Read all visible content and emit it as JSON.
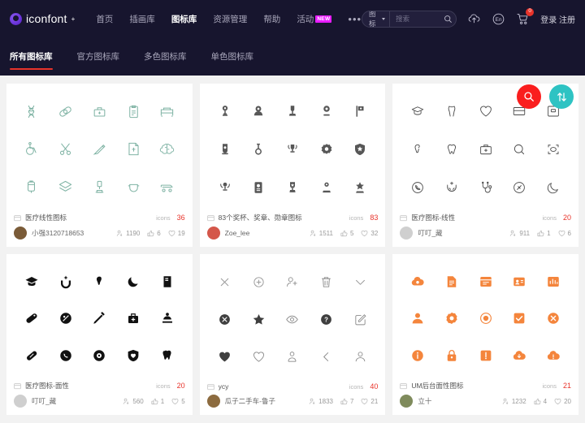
{
  "header": {
    "logo_text": "iconfont",
    "logo_plus": "+",
    "nav": [
      {
        "label": "首页",
        "active": false
      },
      {
        "label": "插画库",
        "active": false
      },
      {
        "label": "图标库",
        "active": true
      },
      {
        "label": "资源管理",
        "active": false
      },
      {
        "label": "帮助",
        "active": false
      },
      {
        "label": "活动",
        "active": false,
        "badge": "NEW"
      }
    ],
    "more_label": "•••",
    "search": {
      "category": "图标",
      "placeholder": "搜索",
      "value": ""
    },
    "upload_icon": "cloud-upload-icon",
    "language_icon": "language-en-icon",
    "cart_icon": "shopping-cart-icon",
    "cart_count": "0",
    "auth": "登录 注册"
  },
  "tabs": [
    {
      "label": "所有图标库",
      "active": true
    },
    {
      "label": "官方图标库",
      "active": false
    },
    {
      "label": "多色图标库",
      "active": false
    },
    {
      "label": "单色图标库",
      "active": false
    }
  ],
  "fab": {
    "search_label": "search-icon",
    "sort_label": "sort-updown-icon"
  },
  "colors": {
    "accent_red": "#e8332a",
    "fab_red": "#fa1e1e",
    "fab_teal": "#2ec3c3",
    "header_bg": "#17152e",
    "page_bg": "#f2f2f2",
    "badge_new": "#e81cff",
    "card1_icons": "#7fb3a4",
    "card2_icons": "#575757",
    "card3_icons": "#4a4a4a",
    "card4_icons": "#111111",
    "card5_icons": "#6b6b6b",
    "card6_icons": "#f4853c"
  },
  "icons_label": "icons",
  "cards": [
    {
      "title": "医疗线性图标",
      "icon_count": "36",
      "author": "小强3120718653",
      "avatar_color": "#7a5b38",
      "downloads": "1190",
      "likes": "6",
      "favorites": "19",
      "icon_color": "#7fb3a4",
      "icon_style": "line",
      "icons": [
        "dna-icon",
        "bandage-icon",
        "medical-scale-icon",
        "clipboard-icon",
        "hospital-bed-icon",
        "wheelchair-icon",
        "scissors-icon",
        "thermometer-icon",
        "prescription-icon",
        "brain-icon",
        "iv-bag-icon",
        "layers-icon",
        "microscope-icon",
        "face-mask-icon",
        "stretcher-icon"
      ]
    },
    {
      "title": "83个奖杯、奖章、勋章图标",
      "icon_count": "83",
      "author": "Zoe_lee",
      "avatar_color": "#d4574a",
      "downloads": "1511",
      "likes": "5",
      "favorites": "32",
      "icon_color": "#575757",
      "icon_style": "solid",
      "icons": [
        "trophy-cup-icon",
        "medal-round-icon",
        "trophy-tall-icon",
        "award-badge-icon",
        "flag-award-icon",
        "medal-pin-icon",
        "medal-ribbon-icon",
        "trophy-wreath-icon",
        "rosette-icon",
        "shield-award-icon",
        "laurel-trophy-icon",
        "certificate-icon",
        "trophy-star-icon",
        "podium-icon",
        "star-badge-icon"
      ]
    },
    {
      "title": "医疗图标-线性",
      "icon_count": "20",
      "author": "叮叮_藏",
      "avatar_color": "#cfcfcf",
      "downloads": "911",
      "likes": "1",
      "favorites": "6",
      "icon_color": "#4a4a4a",
      "icon_style": "thin-line",
      "icons": [
        "graduation-cap-icon",
        "hands-care-icon",
        "heart-outline-icon",
        "card-icon",
        "archive-box-icon",
        "tooth-root-icon",
        "tooth-icon",
        "medicine-box-icon",
        "search-circle-icon",
        "scan-frame-icon",
        "phone-care-icon",
        "hands-sparkle-icon",
        "stethoscope-icon",
        "pill-circle-icon",
        "moon-care-icon"
      ]
    },
    {
      "title": "医疗图标-面性",
      "icon_count": "20",
      "author": "叮叮_藏",
      "avatar_color": "#cfcfcf",
      "downloads": "560",
      "likes": "1",
      "favorites": "5",
      "icon_color": "#111111",
      "icon_style": "solid",
      "icons": [
        "graduation-cap-filled-icon",
        "hands-sparkle-filled-icon",
        "tooth-root-filled-icon",
        "moon-care-filled-icon",
        "book-filled-icon",
        "pill-filled-icon",
        "pill-circle-filled-icon",
        "syringe-icon",
        "medicine-box-filled-icon",
        "microscope-filled-icon",
        "capsule-filled-icon",
        "phone-circle-filled-icon",
        "virus-circle-filled-icon",
        "shield-heart-filled-icon",
        "tooth-filled-icon"
      ]
    },
    {
      "title": "ycy",
      "icon_count": "40",
      "author": "瓜子二手车-鲁子",
      "avatar_color": "#8c6b3f",
      "downloads": "1833",
      "likes": "7",
      "favorites": "21",
      "icon_color": "#6b6b6b",
      "icon_style": "mixed",
      "icons": [
        "close-icon",
        "plus-circle-icon",
        "user-add-icon",
        "trash-icon",
        "chevron-down-icon",
        "close-circle-filled-icon",
        "star-filled-icon",
        "eye-icon",
        "question-circle-filled-icon",
        "edit-square-icon",
        "heart-filled-icon",
        "heart-outline-icon",
        "user-group-icon",
        "chevron-left-icon",
        "user-icon"
      ]
    },
    {
      "title": "UM后台面性图标",
      "icon_count": "21",
      "author": "立十",
      "avatar_color": "#7f8b5c",
      "downloads": "1232",
      "likes": "4",
      "favorites": "20",
      "icon_color": "#f4853c",
      "icon_style": "solid",
      "icons": [
        "cloud-gear-icon",
        "file-filled-icon",
        "window-filled-icon",
        "id-card-filled-icon",
        "chart-card-filled-icon",
        "user-filled-icon",
        "gear-filled-icon",
        "target-filled-icon",
        "check-square-filled-icon",
        "close-circle-orange-icon",
        "info-circle-filled-icon",
        "lock-filled-icon",
        "warning-square-icon",
        "cloud-down-icon",
        "cloud-warning-icon"
      ]
    }
  ]
}
